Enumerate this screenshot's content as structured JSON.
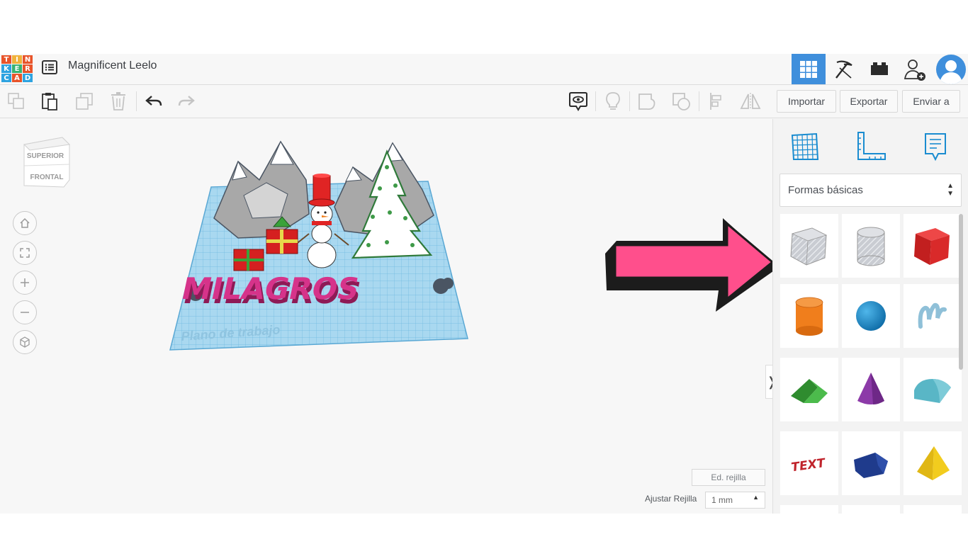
{
  "header": {
    "logo_letters": [
      "T",
      "I",
      "N",
      "K",
      "E",
      "R",
      "C",
      "A",
      "D"
    ],
    "logo_colors": [
      "#e8542a",
      "#f0b23c",
      "#e8542a",
      "#2ea3e0",
      "#3ab372",
      "#e8542a",
      "#2ea3e0",
      "#e8542a",
      "#2ea3e0"
    ],
    "title": "Magnificent Leelo",
    "icons": [
      "grid-view-icon",
      "pickaxe-icon",
      "bricks-icon",
      "add-user-icon",
      "user-avatar-icon"
    ],
    "accent": "#3f8fdc"
  },
  "toolbar": {
    "left_icons": [
      "copy-icon",
      "paste-icon",
      "duplicate-icon",
      "delete-icon",
      "undo-icon",
      "redo-icon"
    ],
    "right_icons": [
      "notes-view-icon",
      "light-bulb-icon",
      "group-shape-icon",
      "ungroup-icon",
      "align-icon",
      "mirror-icon"
    ],
    "import_label": "Importar",
    "export_label": "Exportar",
    "send_label": "Enviar a"
  },
  "viewport": {
    "viewcube_top": "SUPERIOR",
    "viewcube_front": "FRONTAL",
    "view_buttons": [
      "home-view-icon",
      "fit-view-icon",
      "zoom-in-icon",
      "zoom-out-icon",
      "perspective-icon"
    ],
    "model_text": "MILAGROS",
    "workplane_label": "Plano de trabajo",
    "grid_edit_label": "Ed. rejilla",
    "snap_label": "Ajustar Rejilla",
    "snap_value": "1 mm",
    "collapse_symbol": "❭",
    "arrow_color": "#ff4f8c"
  },
  "panel": {
    "tabs": [
      "workplane-grid-icon",
      "ruler-icon",
      "notes-icon"
    ],
    "category_value": "Formas básicas",
    "shapes": [
      {
        "name": "box-hole",
        "color": "#b8bcc4"
      },
      {
        "name": "cylinder-hole",
        "color": "#c8cbd0"
      },
      {
        "name": "box",
        "color": "#d92a2a"
      },
      {
        "name": "cylinder",
        "color": "#f07e1c"
      },
      {
        "name": "sphere",
        "color": "#1d8fd0"
      },
      {
        "name": "scribble",
        "color": "#8fc0d8"
      },
      {
        "name": "roof",
        "color": "#3aa23a"
      },
      {
        "name": "cone",
        "color": "#8c3aa8"
      },
      {
        "name": "round-roof",
        "color": "#59b6c6"
      },
      {
        "name": "text",
        "color": "#c0242c"
      },
      {
        "name": "polygon",
        "color": "#1f3b8c"
      },
      {
        "name": "pyramid",
        "color": "#f2cc1e"
      }
    ]
  }
}
